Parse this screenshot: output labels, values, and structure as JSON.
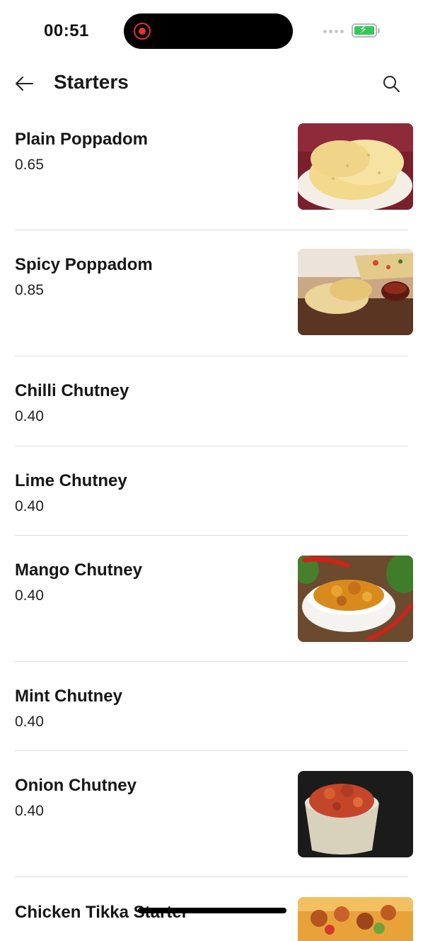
{
  "status": {
    "time": "00:51"
  },
  "header": {
    "title": "Starters"
  },
  "items": [
    {
      "name": "Plain Poppadom",
      "price": "0.65",
      "image": "poppadom-plate"
    },
    {
      "name": "Spicy Poppadom",
      "price": "0.85",
      "image": "poppadom-rolled"
    },
    {
      "name": "Chilli Chutney",
      "price": "0.40"
    },
    {
      "name": "Lime Chutney",
      "price": "0.40"
    },
    {
      "name": "Mango Chutney",
      "price": "0.40",
      "image": "mango-chutney-bowl"
    },
    {
      "name": "Mint Chutney",
      "price": "0.40"
    },
    {
      "name": "Onion Chutney",
      "price": "0.40",
      "image": "onion-chutney-cup"
    },
    {
      "name": "Chicken Tikka Starter",
      "image": "tikka-skewers"
    }
  ],
  "colors": {
    "accent_record": "#e5322d",
    "battery": "#34c759",
    "divider": "#dcdcdc"
  }
}
